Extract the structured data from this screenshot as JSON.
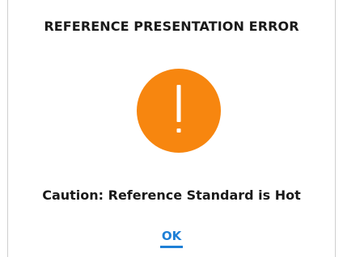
{
  "dialog": {
    "title": "REFERENCE PRESENTATION ERROR",
    "icon": "exclamation-warning-icon",
    "message": "Caution: Reference Standard is Hot",
    "ok_label": "OK"
  },
  "colors": {
    "warning": "#f7860f",
    "accent": "#1e7fd6",
    "text": "#1a1a1a",
    "background": "#ffffff"
  }
}
